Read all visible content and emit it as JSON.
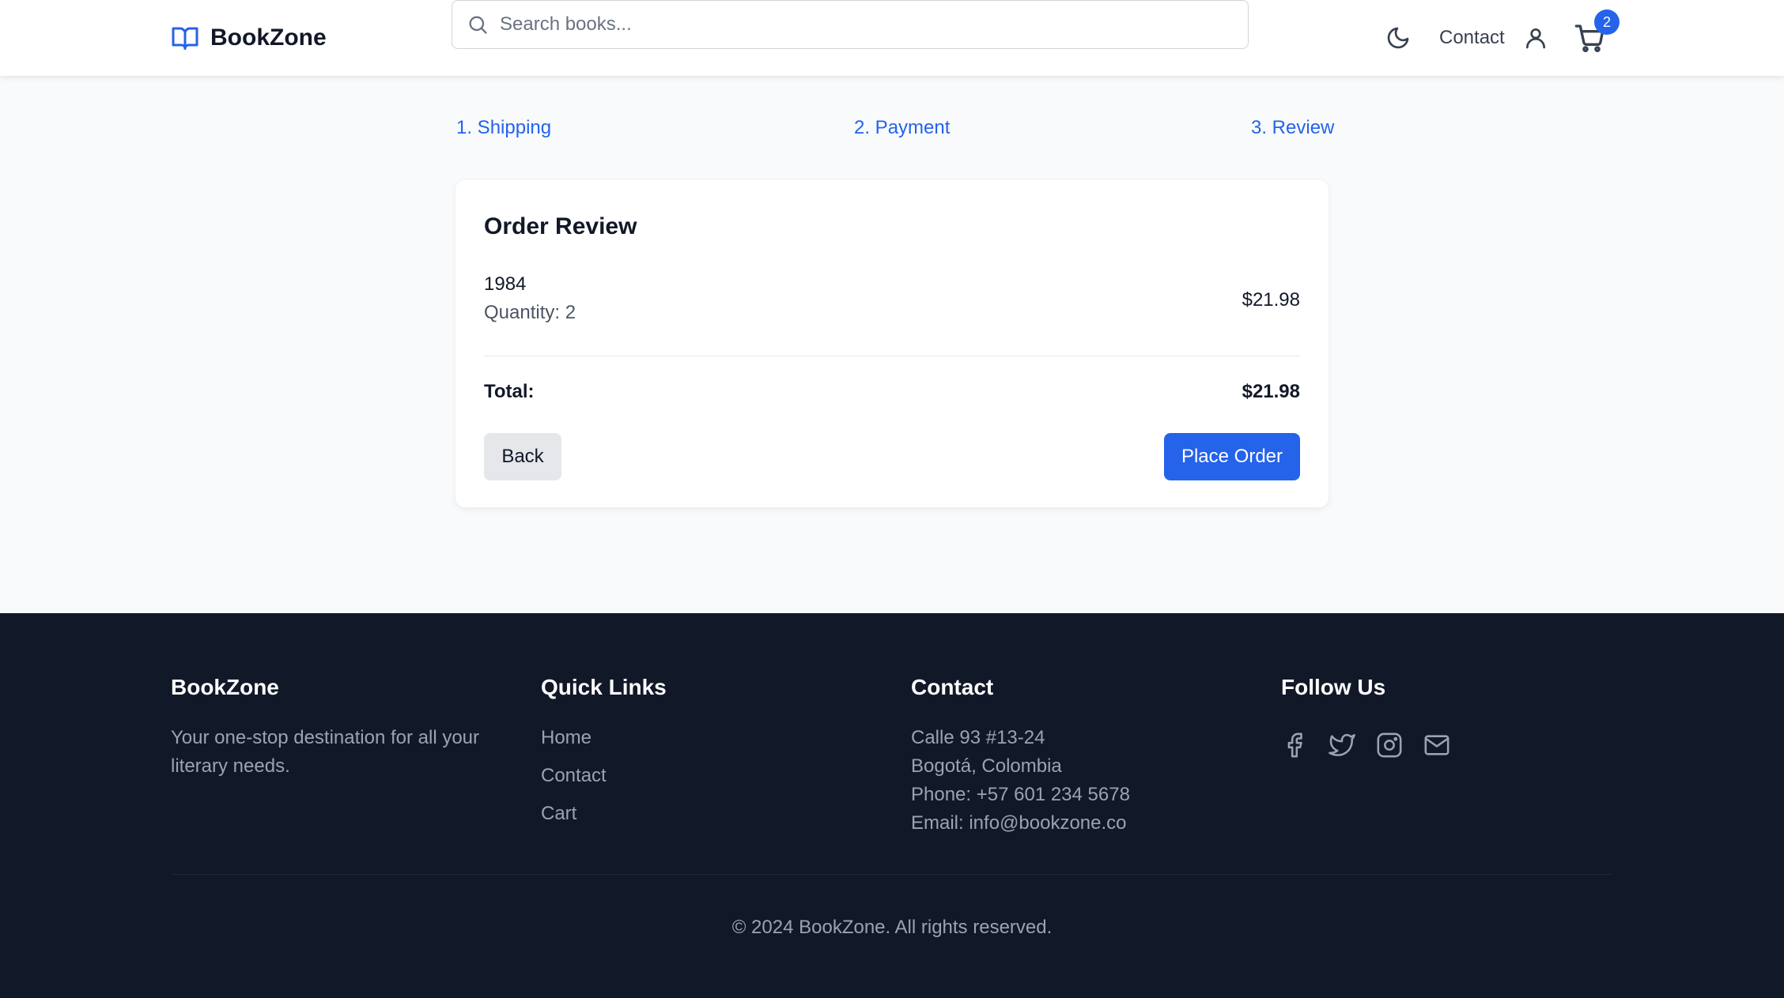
{
  "header": {
    "brand": "BookZone",
    "search_placeholder": "Search books...",
    "contact_label": "Contact",
    "cart_count": "2"
  },
  "steps": [
    "1. Shipping",
    "2. Payment",
    "3. Review"
  ],
  "review": {
    "title": "Order Review",
    "item": {
      "name": "1984",
      "quantity": "Quantity: 2",
      "price": "$21.98"
    },
    "total_label": "Total:",
    "total_value": "$21.98",
    "back_label": "Back",
    "place_order_label": "Place Order"
  },
  "footer": {
    "brand": {
      "heading": "BookZone",
      "tagline": "Your one-stop destination for all your literary needs."
    },
    "quick_links": {
      "heading": "Quick Links",
      "items": [
        "Home",
        "Contact",
        "Cart"
      ]
    },
    "contact": {
      "heading": "Contact",
      "lines": [
        "Calle 93 #13-24",
        "Bogotá, Colombia",
        "Phone: +57 601 234 5678",
        "Email: info@bookzone.co"
      ]
    },
    "follow": {
      "heading": "Follow Us",
      "icons": [
        "facebook-icon",
        "twitter-icon",
        "instagram-icon",
        "mail-icon"
      ]
    },
    "copyright": "© 2024 BookZone. All rights reserved."
  },
  "colors": {
    "accent": "#2563eb",
    "footer_bg": "#111827",
    "page_bg": "#f8fafc"
  }
}
